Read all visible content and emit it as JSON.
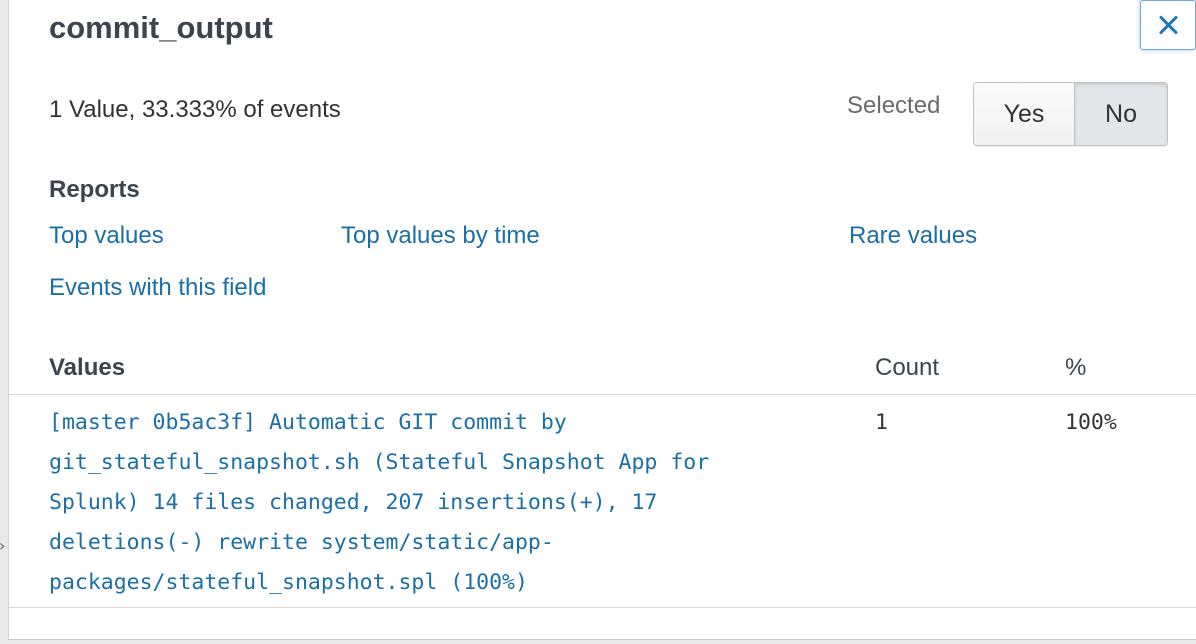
{
  "field": {
    "title": "commit_output",
    "summary": "1 Value, 33.333% of events"
  },
  "selected": {
    "label": "Selected",
    "yes_label": "Yes",
    "no_label": "No",
    "active": "No"
  },
  "reports": {
    "heading": "Reports",
    "links": {
      "top_values": "Top values",
      "top_values_by_time": "Top values by time",
      "rare_values": "Rare values",
      "events_with_field": "Events with this field"
    }
  },
  "table": {
    "headers": {
      "values": "Values",
      "count": "Count",
      "percent": "%"
    },
    "rows": [
      {
        "value": "[master 0b5ac3f] Automatic GIT commit by git_stateful_snapshot.sh (Stateful Snapshot App for Splunk) 14 files changed, 207 insertions(+), 17 deletions(-) rewrite system/static/app-packages/stateful_snapshot.spl (100%)",
        "count": "1",
        "percent": "100%"
      }
    ]
  },
  "icons": {
    "close": "close-icon",
    "chevron": "chevron-right-icon"
  },
  "colors": {
    "link": "#1a6fa6",
    "close_icon": "#1e76b8",
    "heading": "#3c444d"
  }
}
